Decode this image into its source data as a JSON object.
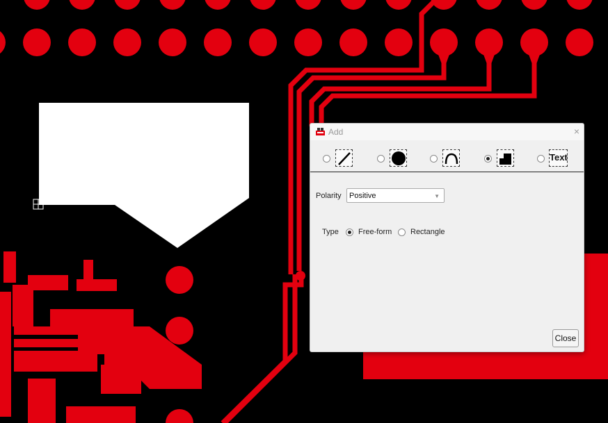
{
  "colors": {
    "copper": "#e3000f",
    "board": "#000000",
    "selection": "#ffffff"
  },
  "dialog": {
    "title": "Add",
    "close_icon": "×",
    "tools": [
      {
        "name": "line",
        "icon": "line-icon",
        "selected": false
      },
      {
        "name": "circle",
        "icon": "filled-circle-icon",
        "selected": false
      },
      {
        "name": "arc",
        "icon": "arc-icon",
        "selected": false
      },
      {
        "name": "polygon",
        "icon": "polygon-icon",
        "selected": true
      },
      {
        "name": "text",
        "label": "Text",
        "selected": false
      }
    ],
    "polarity": {
      "label": "Polarity",
      "value": "Positive",
      "arrow": "▼"
    },
    "type": {
      "label": "Type",
      "options": [
        {
          "label": "Free-form",
          "selected": true
        },
        {
          "label": "Rectangle",
          "selected": false
        }
      ]
    },
    "close_button": "Close"
  }
}
